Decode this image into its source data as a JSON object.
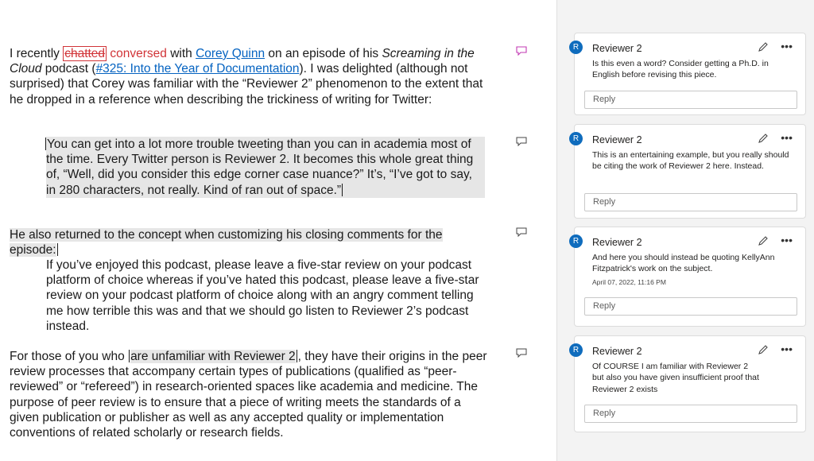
{
  "doc": {
    "p1": {
      "t1": "I recently ",
      "deleted": "chatted",
      "inserted": "conversed",
      "t2": " with ",
      "link1": "Corey Quinn",
      "t3": " on an episode of his ",
      "italic": "Screaming in the Cloud",
      "t4": " podcast (",
      "link2": "#325: Into the Year of Documentation",
      "t5": "). I was delighted (although not surprised) that Corey was familiar with the “Reviewer 2” phenomenon to the extent that he dropped in a reference when describing the trickiness of writing for Twitter:"
    },
    "q1": "You can get into a lot more trouble tweeting than you can in academia most of the time. Every Twitter person is Reviewer 2. It becomes this whole great thing of, “Well, did you consider this edge corner case nuance?” It’s, “I’ve got to say, in 280 characters, not really. Kind of ran out of space.”",
    "p2": "He also returned to the concept when customizing his closing comments for the episode:",
    "q2": "If you’ve enjoyed this podcast, please leave a five-star review on your podcast platform of choice whereas if you’ve hated this podcast, please leave a five-star review on your podcast platform of choice along with an angry comment telling me how terrible this was and that we should go listen to Reviewer 2’s podcast instead.",
    "p3": {
      "t1": "For those of you who ",
      "highlight": "are unfamiliar with Reviewer 2",
      "t2": ", they have their origins in the peer review processes that accompany certain types of publications (qualified as “peer-reviewed” or “refereed”) in research-oriented spaces like academia and medicine. The purpose of peer review is to ensure that a piece of writing meets the standards of a given publication or publisher as well as any accepted quality or implementation conventions of related scholarly or research fields."
    }
  },
  "comments": [
    {
      "initial": "R",
      "author": "Reviewer 2",
      "text": "Is this even a word? Consider getting a Ph.D. in English before revising this piece.",
      "timestamp": "",
      "reply_placeholder": "Reply"
    },
    {
      "initial": "R",
      "author": "Reviewer 2",
      "text": "This is an entertaining example, but you really should be citing the work of Reviewer 2 here. Instead.",
      "timestamp": "",
      "reply_placeholder": "Reply"
    },
    {
      "initial": "R",
      "author": "Reviewer 2",
      "text": "And here you should instead be quoting KellyAnn Fitzpatrick's work on the subject.",
      "timestamp": "April 07, 2022, 11:16 PM",
      "reply_placeholder": "Reply"
    },
    {
      "initial": "R",
      "author": "Reviewer 2",
      "text": "Of COURSE I am familiar with Reviewer 2\nbut also you have given insufficient proof that Reviewer 2 exists",
      "timestamp": "",
      "reply_placeholder": "Reply"
    }
  ],
  "colors": {
    "accent": "#0f6cbd",
    "track_change": "#d13438",
    "link": "#0563c1",
    "active_marker": "#c239b3",
    "highlight": "#e6e6e6"
  },
  "icons": {
    "comment_marker": "speech-bubble-icon",
    "edit": "pencil-icon",
    "more": "ellipsis-icon"
  }
}
